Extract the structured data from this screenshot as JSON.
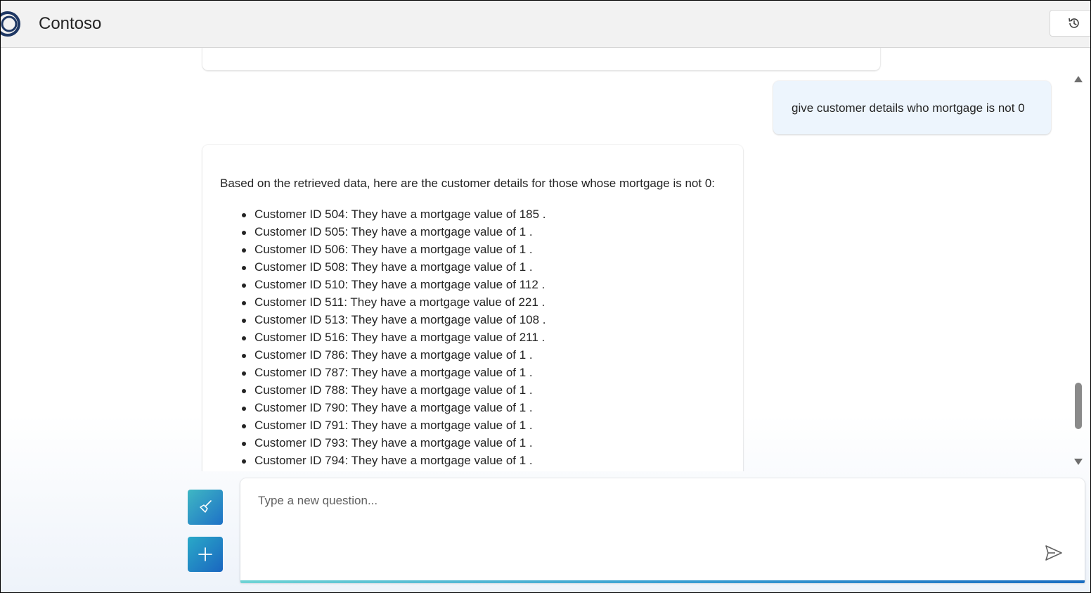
{
  "header": {
    "app_title": "Contoso",
    "logo_icon": "contoso-ring-logo",
    "history_icon": "history-icon"
  },
  "chat": {
    "user_message": "give customer details who mortgage is not 0",
    "answer_intro": "Based on the retrieved data, here are the customer details for those whose mortgage is not 0:",
    "answer_items": [
      "Customer ID 504: They have a mortgage value of 185 .",
      "Customer ID 505: They have a mortgage value of 1 .",
      "Customer ID 506: They have a mortgage value of 1 .",
      "Customer ID 508: They have a mortgage value of 1 .",
      "Customer ID 510: They have a mortgage value of 112 .",
      "Customer ID 511: They have a mortgage value of 221 .",
      "Customer ID 513: They have a mortgage value of 108 .",
      "Customer ID 516: They have a mortgage value of 211 .",
      "Customer ID 786: They have a mortgage value of 1 .",
      "Customer ID 787: They have a mortgage value of 1 .",
      "Customer ID 788: They have a mortgage value of 1 .",
      "Customer ID 790: They have a mortgage value of 1 .",
      "Customer ID 791: They have a mortgage value of 1 .",
      "Customer ID 793: They have a mortgage value of 1 .",
      "Customer ID 794: They have a mortgage value of 1 ."
    ]
  },
  "input": {
    "placeholder": "Type a new question...",
    "value": ""
  },
  "actions": {
    "clear_icon": "broom-icon",
    "new_chat_icon": "plus-icon",
    "send_icon": "send-icon"
  },
  "colors": {
    "header_bg": "#f2f2f2",
    "user_bubble_bg": "#edf5fd",
    "accent_start": "#3fb7c4",
    "accent_end": "#1e72c6"
  }
}
